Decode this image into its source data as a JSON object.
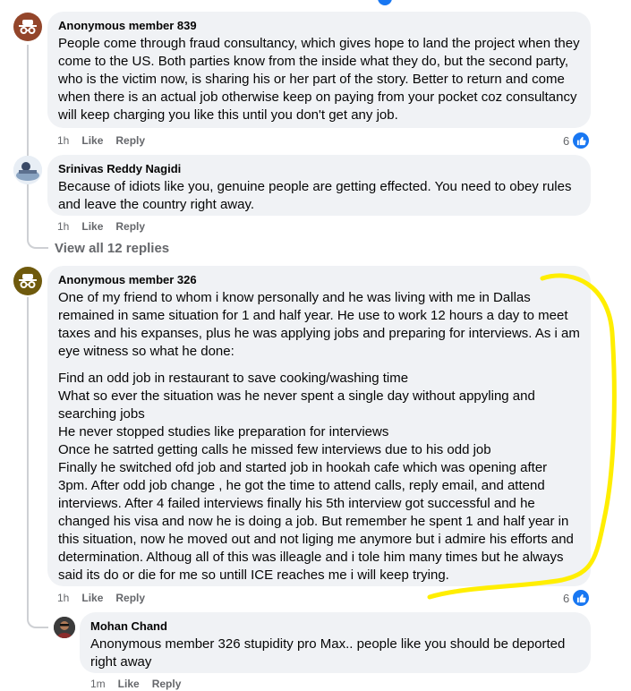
{
  "comments": [
    {
      "author": "Anonymous member 839",
      "text": "People come through fraud consultancy, which gives hope to land the project when they come to the US. Both parties know from the inside what they do, but the second party, who is the victim now, is sharing his or her part of the story. Better to return and come when there is an actual job otherwise keep on paying from your pocket coz consultancy will keep charging you like this until you don't get any job.",
      "time": "1h",
      "like": "Like",
      "reply": "Reply",
      "reactions": "6"
    },
    {
      "author": "Srinivas Reddy Nagidi",
      "text": "Because of idiots like you, genuine people are getting effected. You need to obey rules and leave the country right away.",
      "time": "1h",
      "like": "Like",
      "reply": "Reply"
    },
    {
      "author": "Anonymous member 326",
      "paragraph1": "One of my friend to whom i know personally and he was living with me in Dallas remained in same situation for 1 and half year. He use to work 12 hours a day to meet taxes and his expanses, plus he was applying jobs and preparing for interviews. As i am eye witness so what he done:",
      "paragraph2": "Find an odd job in restaurant to save cooking/washing time\nWhat so ever the situation was he never spent a single day without appyling and searching jobs\nHe never stopped studies like preparation for interviews\nOnce he satrted getting calls he missed few interviews due to his odd job\nFinally he switched ofd job and started job in hookah cafe which was opening after 3pm. After odd job change , he got the time to attend calls, reply email, and attend interviews. After 4 failed interviews finally his 5th interview got successful and he changed his visa and now he is doing a job. But remember he spent 1 and half year in this situation, now he moved out and not liging me anymore but i admire his efforts and determination. Althoug all of this was illeagle and i tole him many times but he always said its do or die for me so untill ICE reaches me i will keep trying.",
      "time": "1h",
      "like": "Like",
      "reply": "Reply",
      "reactions": "6"
    },
    {
      "author": "Mohan Chand",
      "text": "Anonymous member 326 stupidity pro Max.. people like you should be deported right away",
      "time": "1m",
      "like": "Like",
      "reply": "Reply"
    }
  ],
  "view_all_replies": "View all 12 replies",
  "colors": {
    "highlight": "#ffee00",
    "like_blue": "#1877f2",
    "bubble": "#f0f2f5",
    "muted": "#65676b"
  }
}
